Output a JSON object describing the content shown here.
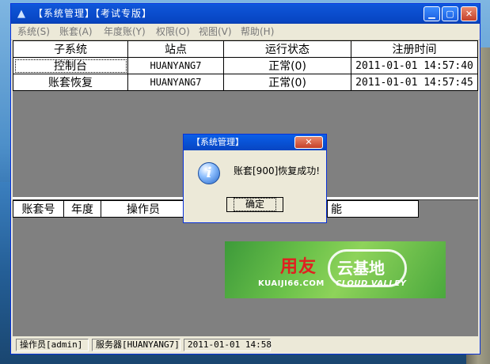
{
  "window": {
    "title": "【系统管理】【考试专版】",
    "controls": {
      "minimize": "▁",
      "maximize": "▢",
      "close": "✕"
    },
    "icon": "app-logo-icon"
  },
  "menu": [
    {
      "label": "系统(S)"
    },
    {
      "label": "账套(A)"
    },
    {
      "label": "年度账(Y)"
    },
    {
      "label": "权限(O)"
    },
    {
      "label": "视图(V)"
    },
    {
      "label": "帮助(H)"
    }
  ],
  "subsystems": {
    "headers": [
      "子系统",
      "站点",
      "运行状态",
      "注册时间"
    ],
    "rows": [
      {
        "name": "控制台",
        "site": "HUANYANG7",
        "status": "正常(0)",
        "time": "2011-01-01 14:57:40"
      },
      {
        "name": "账套恢复",
        "site": "HUANYANG7",
        "status": "正常(0)",
        "time": "2011-01-01 14:57:45"
      }
    ]
  },
  "tasks": {
    "headers": [
      "账套号",
      "年度",
      "操作员",
      "",
      "能"
    ]
  },
  "banner": {
    "brand_cn": "用友",
    "brand_cn2": "云基地",
    "domain": "KUAIJI66.COM",
    "slogan": "CLOUD VALLEY"
  },
  "status_bar": {
    "operator": "操作员[admin]",
    "server": "服务器[HUANYANG7]",
    "datetime": "2011-01-01 14:58"
  },
  "dialog": {
    "title": "【系统管理】",
    "close": "✕",
    "message": "账套[900]恢复成功!",
    "ok_label": "确定",
    "icon": "info-icon"
  }
}
